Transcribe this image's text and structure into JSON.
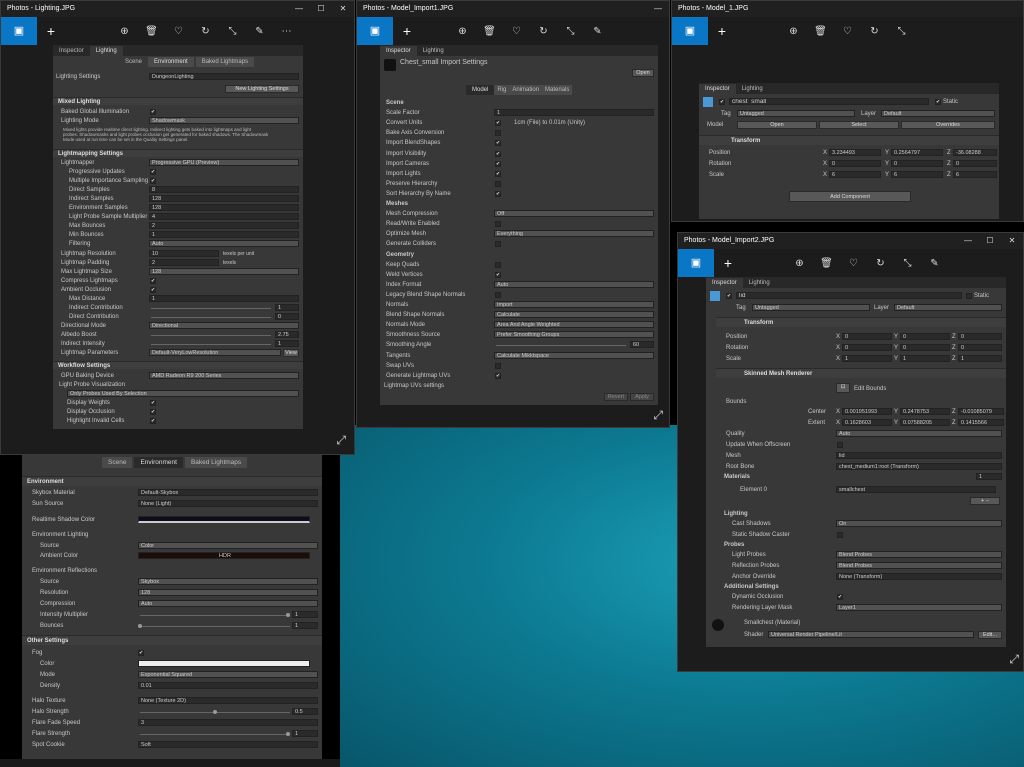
{
  "w1": {
    "title": "Photos - Lighting.JPG",
    "tabs": [
      "Inspector",
      "Lighting"
    ],
    "subtabs": [
      "Scene",
      "Environment",
      "Baked Lightmaps"
    ],
    "lighting_settings_label": "Lighting Settings",
    "lighting_settings_value": "DungeonLighting",
    "new_btn": "New Lighting Settings",
    "mixed_header": "Mixed Lighting",
    "bgi_label": "Baked Global Illumination",
    "mode_label": "Lighting Mode",
    "mode_value": "Shadowmask",
    "info1": "Mixed lights provide realtime direct lighting. Indirect lighting gets baked into lightmaps and light",
    "info2": "probes. Shadowmasks and light probes occlusion get generated for baked shadows. The Shadowmask",
    "info3": "Mode used at run time can be set in the Quality Settings panel.",
    "lm_header": "Lightmapping Settings",
    "rows": [
      [
        "Lightmapper",
        "Progressive GPU (Preview)"
      ],
      [
        "Progressive Updates",
        "✔"
      ],
      [
        "Multiple Importance Sampling",
        "✔"
      ],
      [
        "Direct Samples",
        "8"
      ],
      [
        "Indirect Samples",
        "128"
      ],
      [
        "Environment Samples",
        "128"
      ],
      [
        "Light Probe Sample Multiplier",
        "4"
      ],
      [
        "Max Bounces",
        "2"
      ],
      [
        "Min Bounces",
        "1"
      ],
      [
        "Filtering",
        "Auto"
      ],
      [
        "Lightmap Resolution",
        "10"
      ],
      [
        "Lightmap Padding",
        "2"
      ],
      [
        "Max Lightmap Size",
        "128"
      ],
      [
        "Compress Lightmaps",
        "✔"
      ],
      [
        "Ambient Occlusion",
        "✔"
      ],
      [
        "Max Distance",
        "1"
      ],
      [
        "Indirect Contribution",
        "1"
      ],
      [
        "Direct Contribution",
        "0"
      ],
      [
        "Directional Mode",
        "Directional"
      ],
      [
        "Albedo Boost",
        "2.75"
      ],
      [
        "Indirect Intensity",
        "1"
      ],
      [
        "Lightmap Parameters",
        "Default-VeryLowResolution"
      ]
    ],
    "texels": "texels per unit",
    "texels2": "texels",
    "view_btn": "View",
    "wf_header": "Workflow Settings",
    "gpu_label": "GPU Baking Device",
    "gpu_value": "AMD Radeon R9 200 Series",
    "lpv": "Light Probe Visualization",
    "lpv_value": "Only Probes Used By Selection",
    "dw": "Display Weights",
    "do": "Display Occlusion",
    "hic": "Highlight Invalid Cells"
  },
  "env": {
    "subtabs": [
      "Scene",
      "Environment",
      "Baked Lightmaps"
    ],
    "env_header": "Environment",
    "skybox_label": "Skybox Material",
    "skybox_value": "Default-Skybox",
    "sun_label": "Sun Source",
    "sun_value": "None (Light)",
    "rsc": "Realtime Shadow Color",
    "el": "Environment Lighting",
    "source": "Source",
    "source_value": "Color",
    "ambient": "Ambient Color",
    "hdr": "HDR",
    "er": "Environment Reflections",
    "src2": "Source",
    "src2_value": "Skybox",
    "res": "Resolution",
    "res_value": "128",
    "comp": "Compression",
    "comp_value": "Auto",
    "im": "Intensity Multiplier",
    "im_value": "1",
    "bounces": "Bounces",
    "bounces_value": "1",
    "other_header": "Other Settings",
    "fog": "Fog",
    "color": "Color",
    "mode": "Mode",
    "mode_value": "Exponential Squared",
    "density": "Density",
    "density_value": "0.01",
    "halo_tex": "Halo Texture",
    "halo_tex_value": "None (Texture 2D)",
    "halo_str": "Halo Strength",
    "halo_str_value": "0.5",
    "ffs": "Flare Fade Speed",
    "ffs_value": "3",
    "fs": "Flare Strength",
    "fs_value": "1",
    "cookie": "Spot Cookie",
    "cookie_value": "Soft"
  },
  "w2": {
    "title": "Photos - Model_Import1.JPG",
    "tabs": [
      "Inspector",
      "Lighting"
    ],
    "asset": "Chest_small Import Settings",
    "open_btn": "Open",
    "subtabs": [
      "Model",
      "Rig",
      "Animation",
      "Materials"
    ],
    "rows": [
      [
        "Scene",
        ""
      ],
      [
        "Scale Factor",
        "1"
      ],
      [
        "Convert Units",
        "1cm (File) to 0.01m (Unity)"
      ],
      [
        "Bake Axis Conversion",
        ""
      ],
      [
        "Import BlendShapes",
        "✔"
      ],
      [
        "Import Visibility",
        "✔"
      ],
      [
        "Import Cameras",
        "✔"
      ],
      [
        "Import Lights",
        "✔"
      ],
      [
        "Preserve Hierarchy",
        ""
      ],
      [
        "Sort Hierarchy By Name",
        "✔"
      ],
      [
        "Meshes",
        ""
      ],
      [
        "Mesh Compression",
        "Off"
      ],
      [
        "Read/Write Enabled",
        ""
      ],
      [
        "Optimize Mesh",
        "Everything"
      ],
      [
        "Generate Colliders",
        ""
      ],
      [
        "Geometry",
        ""
      ],
      [
        "Keep Quads",
        ""
      ],
      [
        "Weld Vertices",
        "✔"
      ],
      [
        "Index Format",
        "Auto"
      ],
      [
        "Legacy Blend Shape Normals",
        ""
      ],
      [
        "Normals",
        "Import"
      ],
      [
        "Blend Shape Normals",
        "Calculate"
      ],
      [
        "Normals Mode",
        "Area And Angle Weighted"
      ],
      [
        "Smoothness Source",
        "Prefer Smoothing Groups"
      ],
      [
        "Smoothing Angle",
        "60"
      ],
      [
        "Tangents",
        "Calculate Mikktspace"
      ],
      [
        "Swap UVs",
        ""
      ],
      [
        "Generate Lightmap UVs",
        "✔"
      ],
      [
        "Lightmap UVs settings",
        ""
      ]
    ],
    "revert": "Revert",
    "apply": "Apply"
  },
  "w3": {
    "title": "Photos - Model_1.JPG",
    "tabs": [
      "Inspector",
      "Lighting"
    ],
    "name": "chest_small",
    "static": "Static",
    "tag_label": "Tag",
    "tag_value": "Untagged",
    "layer_label": "Layer",
    "layer_value": "Default",
    "model_label": "Model",
    "open": "Open",
    "select": "Select",
    "overrides": "Overrides",
    "transform": "Transform",
    "pos": "Position",
    "rot": "Rotation",
    "scale": "Scale",
    "px": "3.234493",
    "py": "0.2564797",
    "pz": "-36.08288",
    "rx": "0",
    "ry": "0",
    "rz": "0",
    "sx": "6",
    "sy": "6",
    "sz": "6",
    "add": "Add Component"
  },
  "w4": {
    "title": "Photos - Model_Import2.JPG",
    "tabs": [
      "Inspector",
      "Lighting"
    ],
    "name": "lid",
    "static": "Static",
    "tag_label": "Tag",
    "tag_value": "Untagged",
    "layer_label": "Layer",
    "layer_value": "Default",
    "transform": "Transform",
    "pos": "Position",
    "rot": "Rotation",
    "scale": "Scale",
    "px": "0",
    "py": "0",
    "pz": "0",
    "rx": "0",
    "ry": "0",
    "rz": "0",
    "sx": "1",
    "sy": "1",
    "sz": "1",
    "smr": "Skinned Mesh Renderer",
    "edit_bounds": "Edit Bounds",
    "bounds": "Bounds",
    "center": "Center",
    "extent": "Extent",
    "cx": "0.001951993",
    "cy": "0.2478753",
    "cz": "-0.01085079",
    "ex": "0.1628603",
    "ey": "0.07588205",
    "ez": "0.1415566",
    "quality": "Quality",
    "quality_value": "Auto",
    "uwo": "Update When Offscreen",
    "mesh": "Mesh",
    "mesh_value": "lid",
    "root": "Root Bone",
    "root_value": "chest_medium1:root (Transform)",
    "materials": "Materials",
    "mat_count": "1",
    "el0": "Element 0",
    "el0_value": "smallchest",
    "lighting": "Lighting",
    "cast": "Cast Shadows",
    "cast_value": "On",
    "ssc": "Static Shadow Caster",
    "probes": "Probes",
    "lp": "Light Probes",
    "lp_value": "Blend Probes",
    "rp": "Reflection Probes",
    "rp_value": "Blend Probes",
    "ao": "Anchor Override",
    "ao_value": "None (Transform)",
    "add_settings": "Additional Settings",
    "dyn": "Dynamic Occlusion",
    "rlm": "Rendering Layer Mask",
    "rlm_value": "Layer1",
    "mat_name": "Smallchest (Material)",
    "shader": "Shader",
    "shader_value": "Universal Render Pipeline/Lit",
    "edit": "Edit..."
  }
}
